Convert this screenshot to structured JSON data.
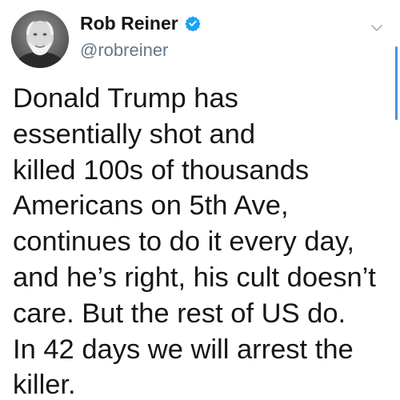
{
  "tweet": {
    "author": {
      "display_name": "Rob Reiner",
      "handle": "@robreiner",
      "verified": true
    },
    "text_lines": [
      "Donald Trump has",
      "essentially shot and",
      "killed 100s of thousands",
      "Americans on 5th Ave,",
      "continues to do it every day,",
      "and he’s right, his cult doesn’t",
      "care. But the rest of US do.",
      "In 42 days we will arrest the",
      "killer."
    ]
  },
  "icons": {
    "verified": "verified-badge-icon",
    "menu": "chevron-down-icon"
  },
  "colors": {
    "verified_blue": "#1da1f2",
    "text": "#14171a",
    "secondary_text": "#657786",
    "scroll_indicator": "#4a90e2"
  }
}
